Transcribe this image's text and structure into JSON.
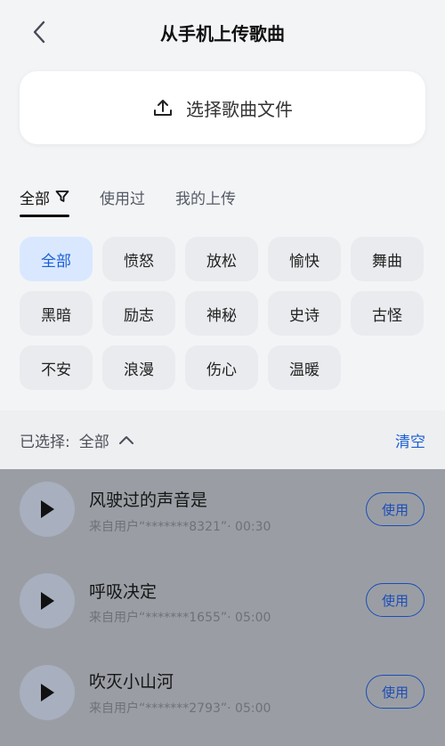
{
  "header": {
    "title": "从手机上传歌曲",
    "back_icon": "chevron-left-icon"
  },
  "upload": {
    "label": "选择歌曲文件",
    "icon": "upload-icon"
  },
  "tabs": [
    {
      "label": "全部",
      "active": true,
      "icon": "filter-icon"
    },
    {
      "label": "使用过",
      "active": false
    },
    {
      "label": "我的上传",
      "active": false
    }
  ],
  "chips": [
    {
      "label": "全部",
      "active": true
    },
    {
      "label": "愤怒",
      "active": false
    },
    {
      "label": "放松",
      "active": false
    },
    {
      "label": "愉快",
      "active": false
    },
    {
      "label": "舞曲",
      "active": false
    },
    {
      "label": "黑暗",
      "active": false
    },
    {
      "label": "励志",
      "active": false
    },
    {
      "label": "神秘",
      "active": false
    },
    {
      "label": "史诗",
      "active": false
    },
    {
      "label": "古怪",
      "active": false
    },
    {
      "label": "不安",
      "active": false
    },
    {
      "label": "浪漫",
      "active": false
    },
    {
      "label": "伤心",
      "active": false
    },
    {
      "label": "温暖",
      "active": false
    }
  ],
  "selection": {
    "label": "已选择:",
    "value": "全部",
    "toggle_icon": "chevron-up-icon",
    "clear_label": "清空"
  },
  "songs": [
    {
      "title": "风驶过的声音是",
      "meta": "来自用户“*******8321”· 00:30",
      "use_label": "使用"
    },
    {
      "title": "呼吸决定",
      "meta": "来自用户“*******1655”· 05:00",
      "use_label": "使用"
    },
    {
      "title": "吹灭小山河",
      "meta": "来自用户“*******2793”· 05:00",
      "use_label": "使用"
    }
  ],
  "colors": {
    "accent": "#1a5fd6",
    "chip_active_bg": "#d9e8ff",
    "overlay": "#9a9ea4"
  }
}
